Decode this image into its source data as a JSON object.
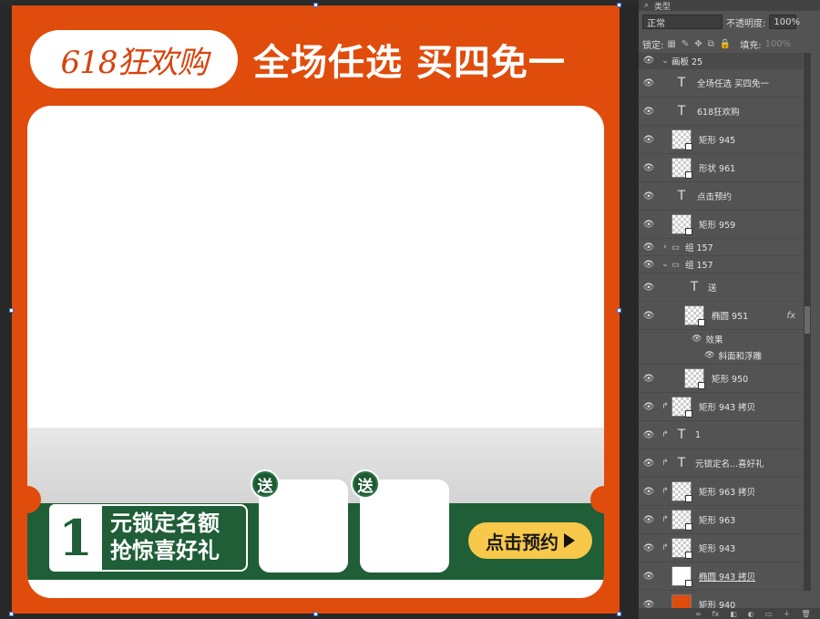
{
  "artboard": {
    "tag": "618狂欢购",
    "headline": "全场任选 买四免一",
    "promo_number": "1",
    "promo_line1": "元锁定名额",
    "promo_line2": "抢惊喜好礼",
    "gift_badge_1": "送",
    "gift_badge_2": "送",
    "cta": "点击预约",
    "colors": {
      "bg": "#e04c0c",
      "green": "#1f5e36",
      "yellow": "#f7c84a"
    }
  },
  "panel": {
    "top_search": "类型",
    "blend_mode": "正常",
    "opacity_label": "不透明度:",
    "opacity_value": "100%",
    "lock_label": "锁定:",
    "fill_label": "填充:",
    "fill_value": "100%",
    "artboard_name": "画板 25",
    "layers": [
      {
        "type": "text",
        "name": "全场任选 买四免一"
      },
      {
        "type": "text",
        "name": "618狂欢购"
      },
      {
        "type": "shape",
        "name": "矩形 945"
      },
      {
        "type": "shape",
        "name": "形状 961"
      },
      {
        "type": "text",
        "name": "点击预约"
      },
      {
        "type": "shape",
        "name": "矩形 959"
      },
      {
        "type": "group",
        "name": "组 157"
      },
      {
        "type": "group",
        "name": "组 157"
      },
      {
        "type": "text",
        "name": "送"
      },
      {
        "type": "shape",
        "name": "椭圆 951"
      },
      {
        "type": "effect",
        "name": "效果"
      },
      {
        "type": "effect",
        "name": "斜面和浮雕"
      },
      {
        "type": "shape",
        "name": "矩形 950"
      },
      {
        "type": "shape",
        "name": "矩形 943 拷贝"
      },
      {
        "type": "text",
        "name": "1"
      },
      {
        "type": "text",
        "name": "元锁定名...喜好礼"
      },
      {
        "type": "shape",
        "name": "矩形 963 拷贝"
      },
      {
        "type": "shape",
        "name": "矩形 963"
      },
      {
        "type": "shape",
        "name": "矩形 943"
      },
      {
        "type": "shape",
        "name": "椭圆 943 拷贝"
      },
      {
        "type": "shape",
        "name": "矩形 940"
      }
    ]
  }
}
